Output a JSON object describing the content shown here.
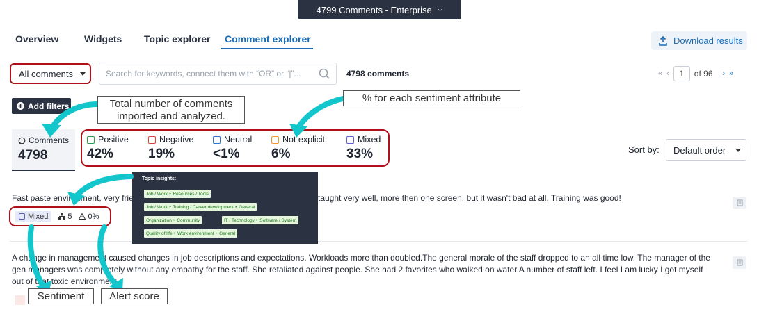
{
  "env_selector": {
    "label": "4799 Comments - Enterprise"
  },
  "tabs": [
    {
      "label": "Overview"
    },
    {
      "label": "Widgets"
    },
    {
      "label": "Topic explorer"
    },
    {
      "label": "Comment explorer"
    }
  ],
  "download": {
    "label": "Download results"
  },
  "filter": {
    "all_comments": "All comments"
  },
  "search": {
    "placeholder": "Search for keywords, connect them with “OR” or “|”..."
  },
  "comment_count": "4798 comments",
  "pager": {
    "page": "1",
    "of_label": "of 96"
  },
  "add_filters": "Add filters",
  "annotations": {
    "total": "Total number of comments imported and analyzed.",
    "percent": "% for each sentiment attribute",
    "sentiment": "Sentiment",
    "alert": "Alert score"
  },
  "stats": {
    "comments_label": "Comments",
    "comments_value": "4798",
    "sentiments": [
      {
        "label": "Positive",
        "value": "42%",
        "color": "#2e9b3e"
      },
      {
        "label": "Negative",
        "value": "19%",
        "color": "#d9403a"
      },
      {
        "label": "Neutral",
        "value": "<1%",
        "color": "#2f6fc4"
      },
      {
        "label": "Not explicit",
        "value": "6%",
        "color": "#e89a2c"
      },
      {
        "label": "Mixed",
        "value": "33%",
        "color": "#5a5fc8"
      }
    ]
  },
  "sort": {
    "label": "Sort by:",
    "value": "Default order"
  },
  "comments": [
    {
      "text": "Fast paste environment, very frie",
      "text_end": "taught very well, more then one screen, but it wasn't bad at all. Training was good!",
      "sentiment": "Mixed",
      "topics_count": "5",
      "alert": "0%"
    },
    {
      "text": "A change in management caused changes in job descriptions and expectations. Workloads more than doubled.The general morale of the staff dropped to an all time low. The manager of the gen managers was completely without any empathy for the staff. She retaliated against people. She had 2 favorites who walked on water.A number of staff left. I feel I am lucky I got myself out of that toxic environment"
    }
  ],
  "topic_insights": {
    "title": "Topic insights:",
    "chips": [
      "Job / Work ‣ Resources / Tools",
      "Job / Work ‣ Training / Career development ‣ General",
      "Organization ‣ Community",
      "IT / Technology ‣ Software / System",
      "Quality of life ‣ Work environment ‣ General"
    ]
  },
  "colors": {
    "accent": "#1a6bb5",
    "highlight": "#b0101a",
    "arrow": "#13c6cc",
    "dark": "#2b3342"
  }
}
